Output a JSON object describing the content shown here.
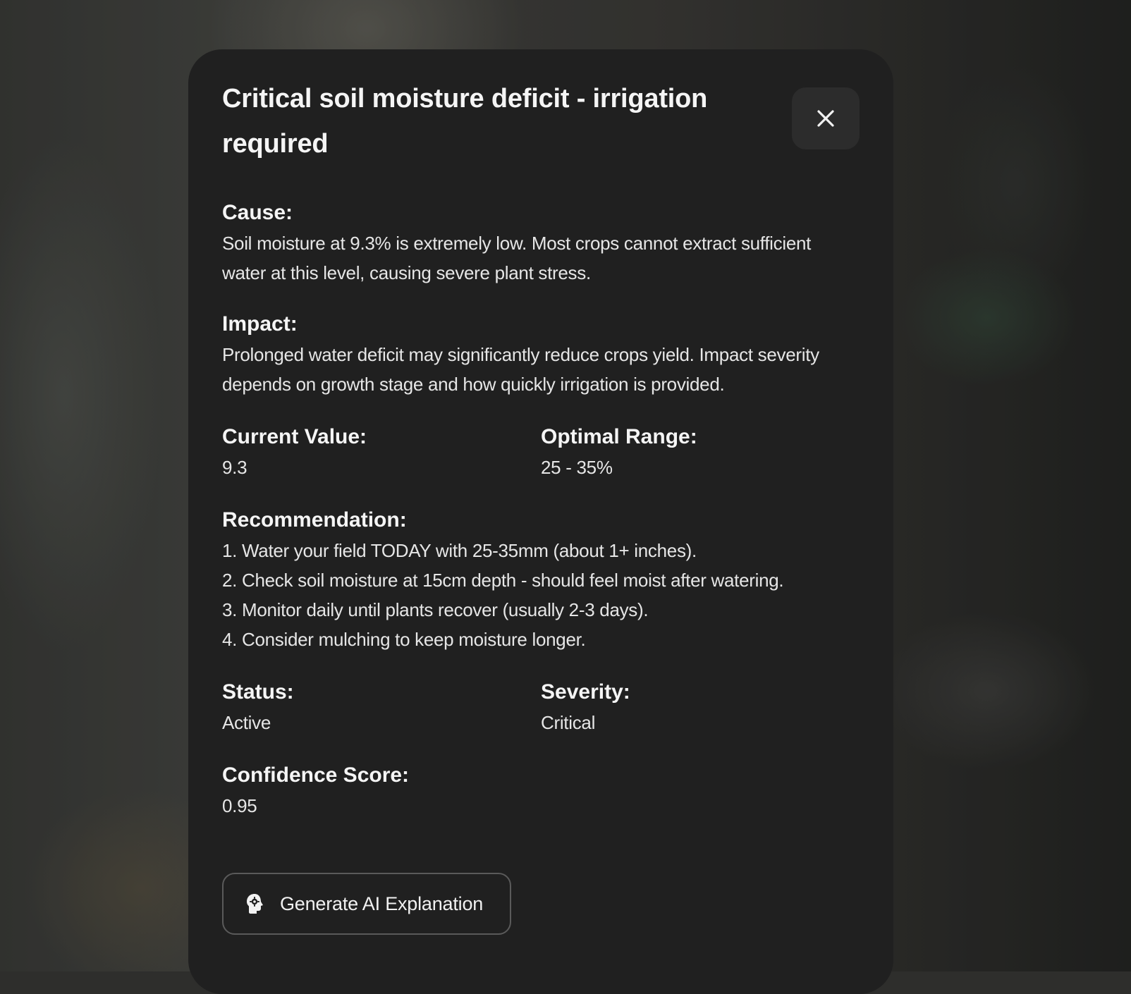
{
  "alert": {
    "title": "Critical soil moisture deficit - irrigation required",
    "close_icon": "close-icon",
    "cause": {
      "label": "Cause:",
      "text": "Soil moisture at 9.3% is extremely low. Most crops cannot extract sufficient water at this level, causing severe plant stress."
    },
    "impact": {
      "label": "Impact:",
      "text": "Prolonged water deficit may significantly reduce crops yield. Impact severity depends on growth stage and how quickly irrigation is provided."
    },
    "current_value": {
      "label": "Current Value:",
      "value": "9.3"
    },
    "optimal_range": {
      "label": "Optimal Range:",
      "value": "25 - 35%"
    },
    "recommendation": {
      "label": "Recommendation:",
      "items": [
        "1. Water your field TODAY with 25-35mm (about 1+ inches).",
        "2. Check soil moisture at 15cm depth - should feel moist after watering.",
        "3. Monitor daily until plants recover (usually 2-3 days).",
        "4. Consider mulching to keep moisture longer."
      ]
    },
    "status": {
      "label": "Status:",
      "value": "Active"
    },
    "severity": {
      "label": "Severity:",
      "value": "Critical"
    },
    "confidence": {
      "label": "Confidence Score:",
      "value": "0.95"
    },
    "ai_button": {
      "label": "Generate AI Explanation",
      "icon": "brain-gear-icon"
    }
  },
  "colors": {
    "modal_bg": "#202020",
    "text": "#f5f5f5",
    "button_border": "#5a5a5a"
  }
}
